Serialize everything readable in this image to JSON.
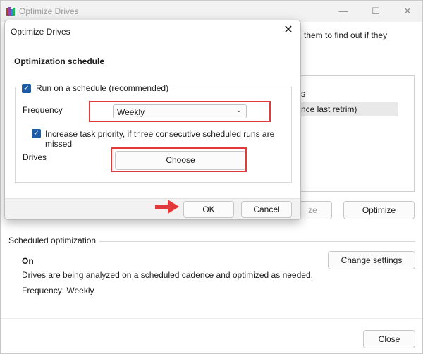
{
  "main": {
    "title": "Optimize Drives",
    "controls": {
      "minimize": "—",
      "maximize": "☐",
      "close": "✕"
    },
    "intro_fragment": "them to find out if they",
    "list_header_fragment": "s",
    "list_selected_fragment": "nce last retrim)",
    "analyze_fragment": "ze",
    "optimize_label": "Optimize",
    "scheduled": {
      "section_label": "Scheduled optimization",
      "status": "On",
      "description": "Drives are being analyzed on a scheduled cadence and optimized as needed.",
      "frequency_text": "Frequency: Weekly",
      "change_settings_label": "Change settings"
    },
    "close_label": "Close"
  },
  "dialog": {
    "title": "Optimize Drives",
    "close_glyph": "✕",
    "heading": "Optimization schedule",
    "run_on_schedule": {
      "label": "Run on a schedule (recommended)",
      "checked": true
    },
    "frequency": {
      "label": "Frequency",
      "value": "Weekly"
    },
    "increase_priority": {
      "label": "Increase task priority, if three consecutive scheduled runs are missed",
      "checked": true
    },
    "drives": {
      "label": "Drives",
      "button": "Choose"
    },
    "ok_label": "OK",
    "cancel_label": "Cancel"
  },
  "colors": {
    "highlight": "#e23a3a",
    "checkbox": "#1e5ca8"
  }
}
